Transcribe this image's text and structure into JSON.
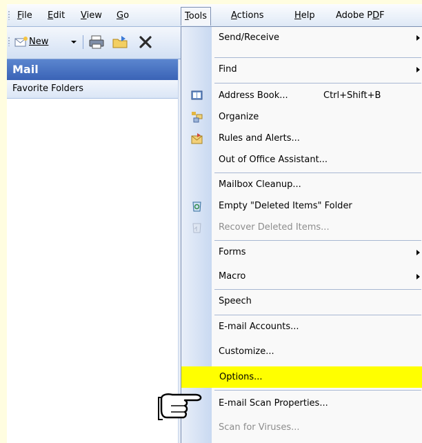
{
  "menubar": {
    "items": [
      {
        "label": "File"
      },
      {
        "label": "Edit"
      },
      {
        "label": "View"
      },
      {
        "label": "Go"
      },
      {
        "label": "Tools"
      },
      {
        "label": "Actions"
      },
      {
        "label": "Help"
      },
      {
        "label": "Adobe PDF"
      }
    ]
  },
  "toolbar": {
    "new_label": "New"
  },
  "nav": {
    "title": "Mail",
    "favorites_label": "Favorite Folders"
  },
  "tools_menu": {
    "items": [
      {
        "label": "Send/Receive",
        "submenu": true
      },
      {
        "label": "Find",
        "submenu": true
      },
      {
        "label": "Address Book...",
        "shortcut": "Ctrl+Shift+B",
        "icon": "address-book-icon"
      },
      {
        "label": "Organize",
        "icon": "organize-icon"
      },
      {
        "label": "Rules and Alerts...",
        "icon": "rules-icon"
      },
      {
        "label": "Out of Office Assistant..."
      },
      {
        "label": "Mailbox Cleanup..."
      },
      {
        "label": "Empty \"Deleted Items\" Folder",
        "icon": "recycle-bin-icon"
      },
      {
        "label": "Recover Deleted Items...",
        "disabled": true,
        "icon": "recover-icon"
      },
      {
        "label": "Forms",
        "submenu": true
      },
      {
        "label": "Macro",
        "submenu": true
      },
      {
        "label": "Speech"
      },
      {
        "label": "E-mail Accounts..."
      },
      {
        "label": "Customize..."
      },
      {
        "label": "Options...",
        "highlighted": true
      },
      {
        "label": "E-mail Scan Properties..."
      },
      {
        "label": "Scan for Viruses...",
        "disabled": true
      }
    ]
  },
  "colors": {
    "highlight": "#ffff00",
    "nav_header": "#3a63b6",
    "page_background": "#fffde0"
  },
  "pointer": "hand-pointer-icon"
}
